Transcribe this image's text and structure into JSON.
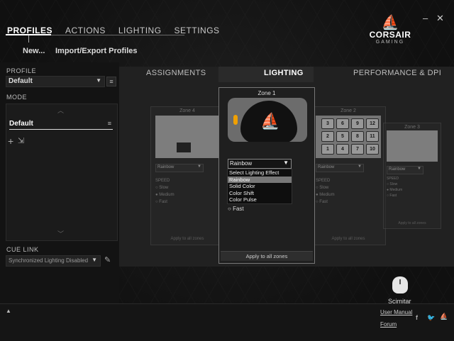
{
  "nav": {
    "tabs": [
      "PROFILES",
      "ACTIONS",
      "LIGHTING",
      "SETTINGS"
    ],
    "sub": [
      "New...",
      "Import/Export Profiles"
    ]
  },
  "window": {
    "minimize": "–",
    "close": "✕"
  },
  "logo": {
    "brand": "CORSAIR",
    "sub": "GAMING"
  },
  "left": {
    "profile_label": "PROFILE",
    "profile_value": "Default",
    "mode_label": "MODE",
    "mode_item": "Default",
    "cue_link_label": "CUE LINK",
    "cue_link_value": "Synchronized Lighting Disabled"
  },
  "center": {
    "tabs": [
      "ASSIGNMENTS",
      "LIGHTING",
      "PERFORMANCE & DPI"
    ],
    "zones": [
      {
        "title": "Zone 4",
        "effect": "Rainbow",
        "speed": "SPEED",
        "opts": [
          "Slow",
          "Medium",
          "Fast"
        ],
        "apply": "Apply to all zones"
      },
      {
        "title": "Zone 2",
        "effect": "Rainbow",
        "speed": "SPEED",
        "opts": [
          "Slow",
          "Medium",
          "Fast"
        ],
        "apply": "Apply to all zones"
      },
      {
        "title": "Zone 3",
        "effect": "Rainbow",
        "speed": "SPEED",
        "opts": [
          "Slow",
          "Medium",
          "Fast"
        ],
        "apply": "Apply to all zones"
      }
    ],
    "numpad": [
      "3",
      "6",
      "9",
      "12",
      "2",
      "5",
      "8",
      "11",
      "1",
      "4",
      "7",
      "10"
    ],
    "popup": {
      "title": "Zone 1",
      "effect": "Rainbow",
      "options": [
        "Select Lighting Effect",
        "Rainbow",
        "Solid Color",
        "Color Shift",
        "Color Pulse"
      ],
      "selected_index": 1,
      "fast": "Fast",
      "apply": "Apply to all zones"
    }
  },
  "device": {
    "name": "Scimitar"
  },
  "footer": {
    "manual": "User Manual",
    "forum": "Forum"
  },
  "colors": {
    "accent": "#e8245a",
    "panel": "#212121"
  }
}
